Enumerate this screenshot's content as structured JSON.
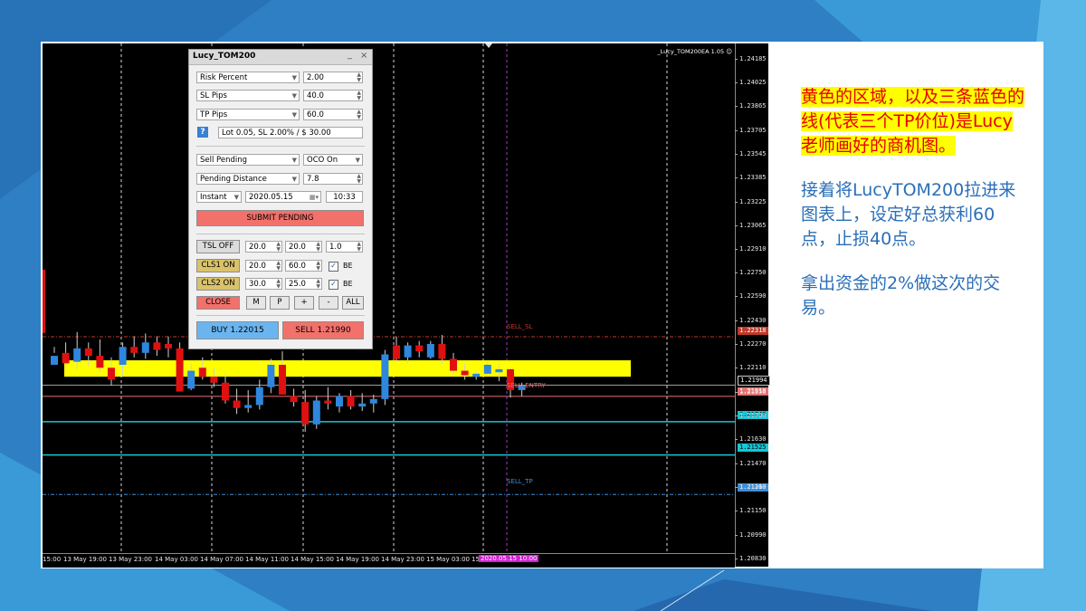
{
  "panel": {
    "title": "Lucy_TOM200",
    "min_glyph": "_",
    "close_glyph": "×",
    "risk_mode": "Risk Percent",
    "risk_value": "2.00",
    "sl_mode": "SL Pips",
    "sl_value": "40.0",
    "tp_mode": "TP Pips",
    "tp_value": "60.0",
    "help_glyph": "?",
    "lot_info": "Lot 0.05, SL 2.00% / $ 30.00",
    "order_type": "Sell Pending",
    "oco": "OCO On",
    "pending_mode": "Pending Distance",
    "pending_value": "7.8",
    "exec_mode": "Instant",
    "date": "2020.05.15",
    "time": "10:33",
    "submit": "SUBMIT PENDING",
    "tsl_label": "TSL OFF",
    "tsl_v1": "20.0",
    "tsl_v2": "20.0",
    "tsl_v3": "1.0",
    "cls1_label": "CLS1 ON",
    "cls1_v1": "20.0",
    "cls1_v2": "60.0",
    "cls1_be": "BE",
    "cls2_label": "CLS2 ON",
    "cls2_v1": "30.0",
    "cls2_v2": "25.0",
    "cls2_be": "BE",
    "close": "CLOSE",
    "m": "M",
    "p": "P",
    "plus": "+",
    "minus": "-",
    "all": "ALL",
    "buy": "BUY 1.22015",
    "sell": "SELL 1.21990",
    "colors": {
      "submit": "#f2716b",
      "buy": "#6ab5f0",
      "sell": "#f2716b",
      "cls_on": "#d9c26a",
      "close": "#f2716b"
    }
  },
  "chart": {
    "ea_label": "_Lucy_TOM200EA  1.05",
    "y_ticks": [
      "1.24185",
      "1.24025",
      "1.23865",
      "1.23705",
      "1.23545",
      "1.23385",
      "1.23225",
      "1.23065",
      "1.22910",
      "1.22750",
      "1.22590",
      "1.22430",
      "1.22270",
      "1.22110",
      "1.21950",
      "1.21790",
      "1.21630",
      "1.21470",
      "1.21310",
      "1.21150",
      "1.20990",
      "1.20830"
    ],
    "x_labels": [
      "15:00",
      "13 May 19:00",
      "13 May 23:00",
      "14 May 03:00",
      "14 May 07:00",
      "14 May 11:00",
      "14 May 15:00",
      "14 May 19:00",
      "14 May 23:00",
      "15 May 03:00",
      "15"
    ],
    "x_highlight": "2020.05.15 10:00",
    "lines": {
      "sell_sl": {
        "label": "SELL_SL",
        "price": "1.22318",
        "color": "#c0392b"
      },
      "sell_entry": {
        "label": "SELL_ENTRY",
        "price": "1.21918",
        "color": "#e57373"
      },
      "bid": {
        "price": "1.21994"
      },
      "tp_a": {
        "price": "1.21748",
        "color": "#19c6d6"
      },
      "tp_b": {
        "price": "1.21525",
        "color": "#19c6d6"
      },
      "sell_tp": {
        "label": "SELL_TP",
        "price": "1.21260",
        "color": "#3f8ed8"
      }
    },
    "candle_colors": {
      "up": "#2e86de",
      "down": "#e01010",
      "zone": "#ffff00"
    }
  },
  "chart_data": {
    "type": "candlestick",
    "ylim": [
      1.2083,
      1.2425
    ],
    "zone": {
      "from": 1.2205,
      "to": 1.2216
    },
    "candles": [
      [
        1.2213,
        1.2225,
        1.2221,
        1.2219
      ],
      [
        1.2221,
        1.2228,
        1.2209,
        1.2214
      ],
      [
        1.2215,
        1.2235,
        1.221,
        1.2224
      ],
      [
        1.2224,
        1.2228,
        1.2212,
        1.2219
      ],
      [
        1.2219,
        1.223,
        1.2208,
        1.2211
      ],
      [
        1.2211,
        1.2218,
        1.2199,
        1.2203
      ],
      [
        1.2213,
        1.2228,
        1.2205,
        1.2225
      ],
      [
        1.2225,
        1.2232,
        1.2218,
        1.2221
      ],
      [
        1.2221,
        1.2234,
        1.2217,
        1.2228
      ],
      [
        1.2228,
        1.2232,
        1.2219,
        1.2223
      ],
      [
        1.2227,
        1.2232,
        1.2218,
        1.2224
      ],
      [
        1.2224,
        1.2228,
        1.2196,
        1.2195
      ],
      [
        1.2197,
        1.2214,
        1.2196,
        1.2209
      ],
      [
        1.2211,
        1.2218,
        1.2203,
        1.2205
      ],
      [
        1.2205,
        1.2211,
        1.2198,
        1.2201
      ],
      [
        1.2201,
        1.2207,
        1.2187,
        1.2189
      ],
      [
        1.2189,
        1.2197,
        1.218,
        1.2184
      ],
      [
        1.2184,
        1.2196,
        1.2181,
        1.2186
      ],
      [
        1.2186,
        1.2203,
        1.2183,
        1.2198
      ],
      [
        1.2198,
        1.2217,
        1.2194,
        1.2213
      ],
      [
        1.2213,
        1.2222,
        1.2195,
        1.2193
      ],
      [
        1.2192,
        1.2197,
        1.2185,
        1.2188
      ],
      [
        1.2188,
        1.2196,
        1.2168,
        1.2173
      ],
      [
        1.2173,
        1.2192,
        1.217,
        1.2189
      ],
      [
        1.2189,
        1.2198,
        1.2183,
        1.2187
      ],
      [
        1.2185,
        1.2194,
        1.2181,
        1.2192
      ],
      [
        1.2192,
        1.2196,
        1.2183,
        1.2185
      ],
      [
        1.2185,
        1.2194,
        1.2182,
        1.2187
      ],
      [
        1.2187,
        1.2193,
        1.2181,
        1.219
      ],
      [
        1.219,
        1.2223,
        1.2186,
        1.222
      ],
      [
        1.2226,
        1.2232,
        1.2215,
        1.2217
      ],
      [
        1.2218,
        1.2228,
        1.2214,
        1.2226
      ],
      [
        1.2226,
        1.2229,
        1.2218,
        1.2222
      ],
      [
        1.2218,
        1.2229,
        1.2217,
        1.2227
      ],
      [
        1.2227,
        1.2233,
        1.2214,
        1.2217
      ],
      [
        1.2217,
        1.2221,
        1.2206,
        1.2209
      ],
      [
        1.2209,
        1.2214,
        1.2203,
        1.2206
      ],
      [
        1.2205,
        1.2209,
        1.2203,
        1.2207
      ],
      [
        1.2207,
        1.2215,
        1.2205,
        1.2213
      ],
      [
        1.2208,
        1.2214,
        1.2202,
        1.221
      ],
      [
        1.221,
        1.2211,
        1.2191,
        1.2196
      ],
      [
        1.2196,
        1.2201,
        1.2192,
        1.2199
      ]
    ]
  },
  "text": {
    "highlight": "黄色的区域，以及三条蓝色的线(代表三个TP价位)是Lucy老师画好的商机图。",
    "p1": "接着将LucyTOM200拉进来图表上，设定好总获利60点，止损40点。",
    "p2": "拿出资金的2%做这次的交易。"
  }
}
